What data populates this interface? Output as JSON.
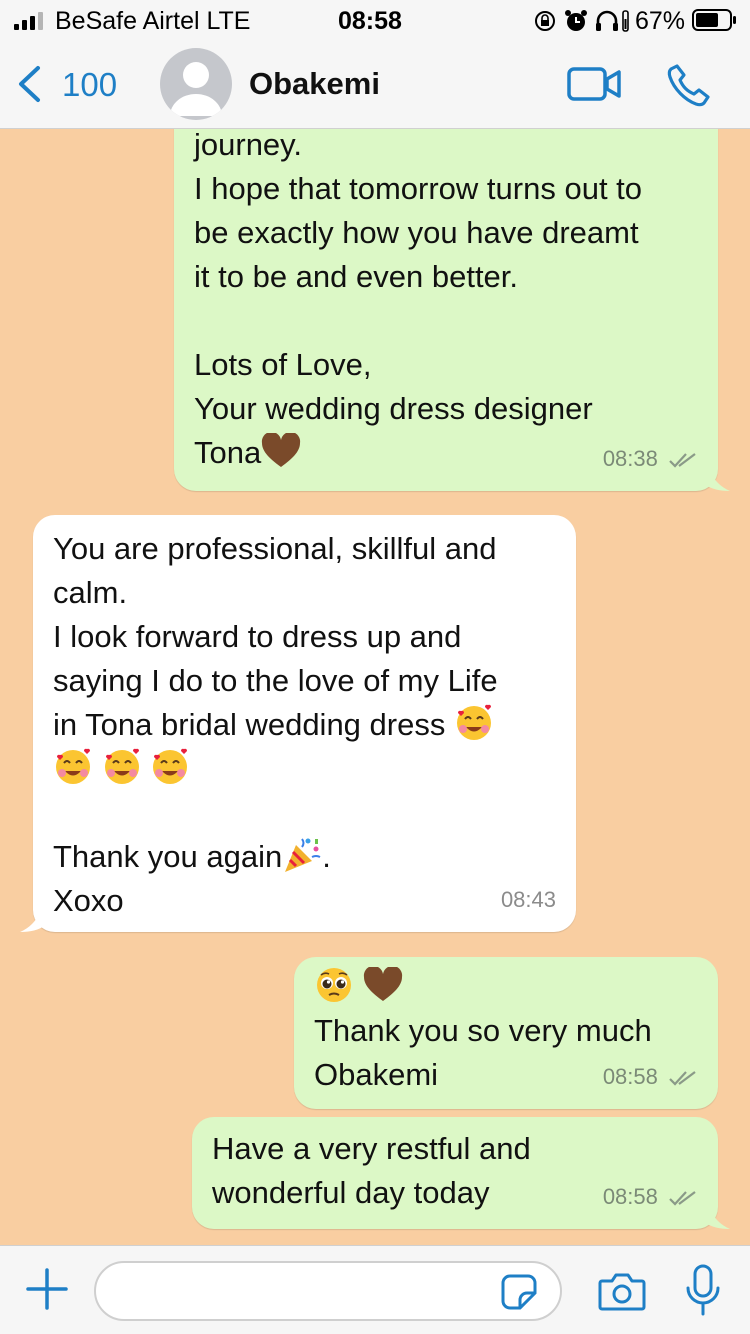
{
  "status_bar": {
    "carrier": "BeSafe Airtel  LTE",
    "time": "08:58",
    "battery_pct": "67%"
  },
  "header": {
    "back_count": "100",
    "contact_name": "Obakemi"
  },
  "messages": [
    {
      "direction": "outgoing",
      "lines": [
        "journey.",
        "I hope that tomorrow turns out to",
        "be exactly how you have dreamt",
        "it to be and even better.",
        "",
        "Lots of Love,",
        "Your wedding dress designer",
        "Tona"
      ],
      "emojis": [
        "brown-heart"
      ],
      "time": "08:38",
      "status": "read"
    },
    {
      "direction": "incoming",
      "lines": [
        "You are professional, skillful and",
        "calm.",
        "I look forward to dress up and",
        "saying I do to the love of my Life",
        "in Tona bridal wedding dress",
        "",
        "",
        "Thank you again",
        "Xoxo"
      ],
      "emojis": [
        "smiling-face-with-hearts",
        "smiling-face-with-hearts",
        "smiling-face-with-hearts",
        "smiling-face-with-hearts",
        "party-popper"
      ],
      "time": "08:43"
    },
    {
      "direction": "outgoing",
      "lines": [
        "",
        "Thank you so very much",
        "Obakemi"
      ],
      "emojis": [
        "pleading-face",
        "brown-heart"
      ],
      "time": "08:58",
      "status": "read"
    },
    {
      "direction": "outgoing",
      "lines": [
        "Have a very restful and",
        "wonderful day today"
      ],
      "time": "08:58",
      "status": "read"
    }
  ],
  "composer": {
    "placeholder": ""
  },
  "colors": {
    "chat_background": "#f9cea1",
    "outgoing_bubble": "#dcf8c6",
    "incoming_bubble": "#ffffff",
    "accent": "#1e7fc6"
  }
}
